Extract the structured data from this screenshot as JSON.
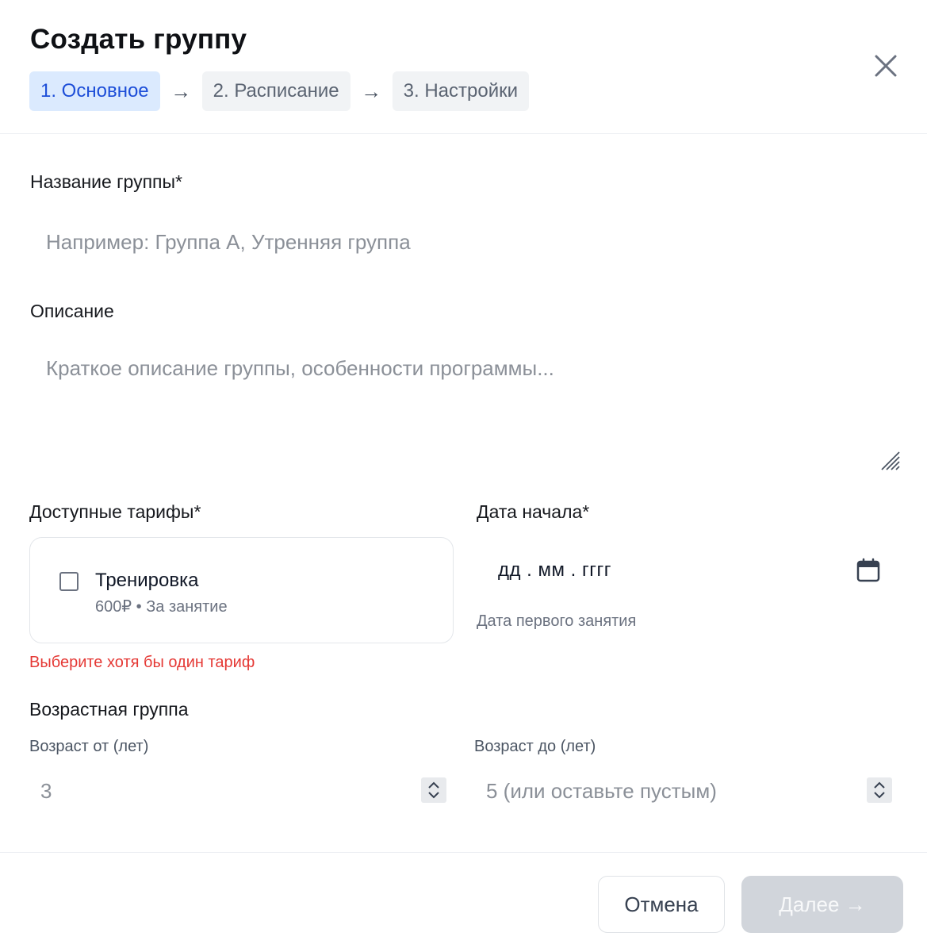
{
  "dialog": {
    "title": "Создать группу",
    "steps": [
      {
        "label": "1. Основное",
        "active": true
      },
      {
        "label": "2. Расписание",
        "active": false
      },
      {
        "label": "3. Настройки",
        "active": false
      }
    ],
    "step_arrow": "→",
    "close_icon": "close-icon"
  },
  "form": {
    "group_name": {
      "label": "Название группы*",
      "placeholder": "Например: Группа А, Утренняя группа",
      "value": ""
    },
    "description": {
      "label": "Описание",
      "placeholder": "Краткое описание группы, особенности программы...",
      "value": ""
    },
    "tariffs": {
      "label": "Доступные тарифы*",
      "items": [
        {
          "name": "Тренировка",
          "meta": "600₽ • За занятие",
          "checked": false
        }
      ],
      "error": "Выберите хотя бы один тариф"
    },
    "start_date": {
      "label": "Дата начала*",
      "value": "дд . мм . гггг",
      "hint": "Дата первого занятия",
      "icon": "calendar-icon"
    },
    "age_group": {
      "label": "Возрастная группа",
      "from": {
        "label": "Возраст от (лет)",
        "placeholder": "3"
      },
      "to": {
        "label": "Возраст до (лет)",
        "placeholder": "5 (или оставьте пустым)"
      }
    }
  },
  "footer": {
    "cancel_label": "Отмена",
    "next_label": "Далее →"
  },
  "colors": {
    "active_step_bg": "#dbeafe",
    "active_step_text": "#1d4ed8",
    "error": "#e53935",
    "disabled_button": "#d1d5db"
  }
}
